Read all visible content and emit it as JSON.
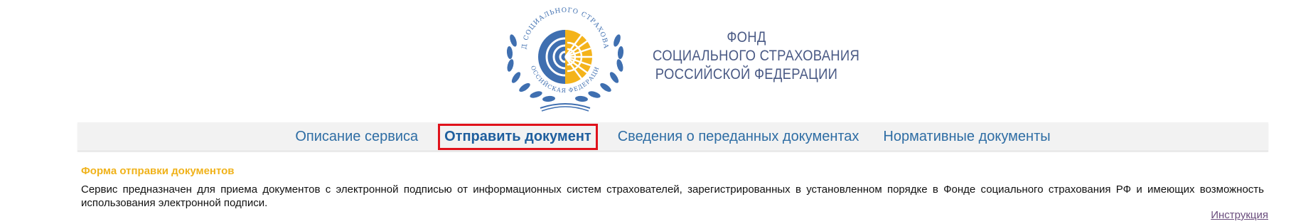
{
  "header": {
    "emblem_text": "ФОНД СОЦИАЛЬНОГО СТРАХОВАНИЯ РОССИЙСКАЯ ФЕДЕРАЦИЯ",
    "org_name_lines": [
      "ФОНД",
      "СОЦИАЛЬНОГО СТРАХОВАНИЯ",
      "РОССИЙСКОЙ ФЕДЕРАЦИИ"
    ]
  },
  "nav": {
    "items": [
      {
        "label": "Описание сервиса",
        "active": false
      },
      {
        "label": "Отправить документ",
        "active": true
      },
      {
        "label": "Сведения о переданных документах",
        "active": false
      },
      {
        "label": "Нормативные документы",
        "active": false
      }
    ]
  },
  "content": {
    "form_title": "Форма отправки документов",
    "description": "Сервис предназначен для приема документов с электронной подписью от информационных систем страхователей, зарегистрированных в установленном порядке в Фонде социального страхования РФ и имеющих возможность использования электронной подписи.",
    "instruction_link": "Инструкция"
  },
  "colors": {
    "nav_link": "#2e6da4",
    "active_border": "#e0121b",
    "form_title": "#f0b21a",
    "emblem_blue": "#3f6fb0",
    "emblem_yellow": "#f4b31a",
    "org_name": "#4a5a85"
  }
}
